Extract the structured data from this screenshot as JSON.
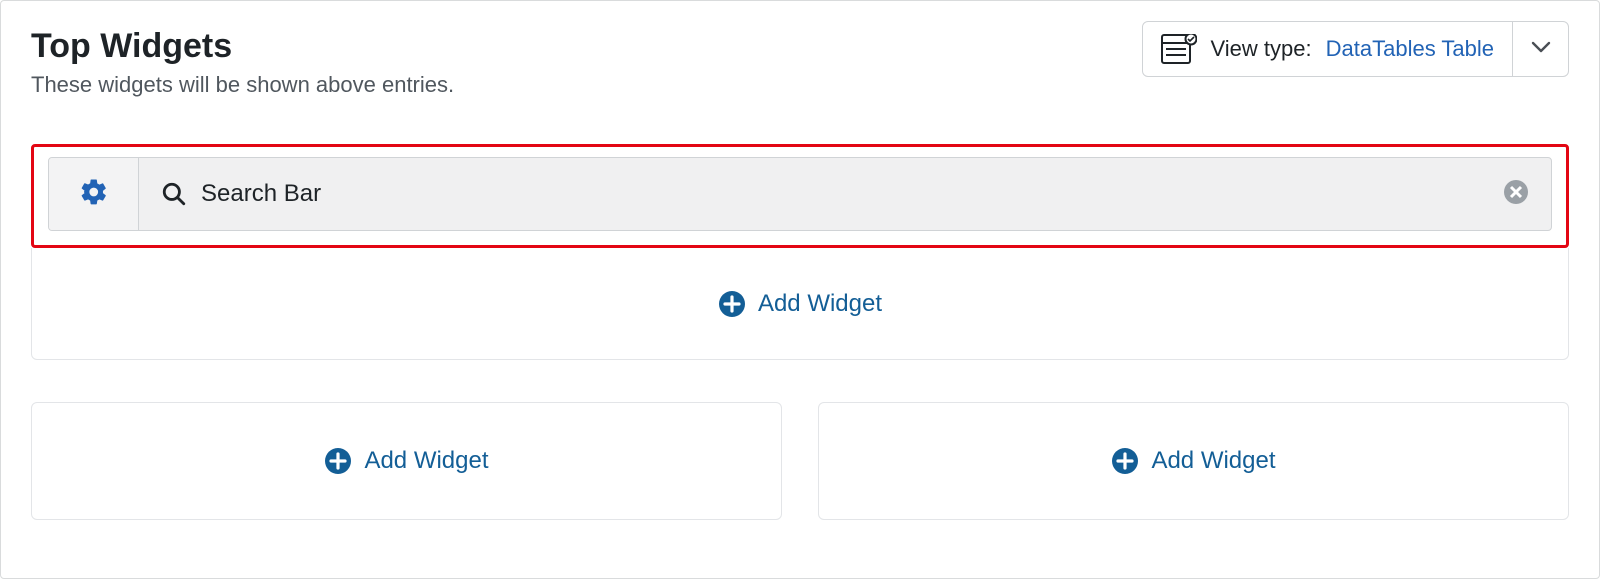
{
  "header": {
    "title": "Top Widgets",
    "subtitle": "These widgets will be shown above entries."
  },
  "view_type": {
    "label": "View type:",
    "value": "DataTables Table"
  },
  "widget": {
    "name": "Search Bar"
  },
  "actions": {
    "add_widget": "Add Widget"
  }
}
